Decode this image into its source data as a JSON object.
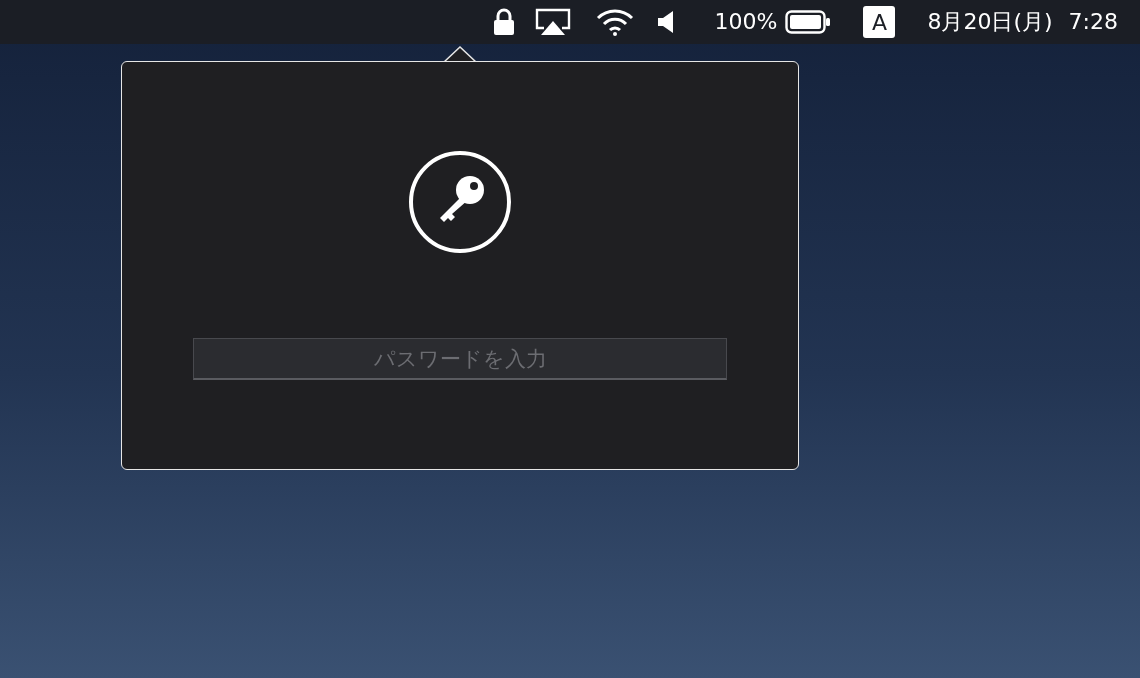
{
  "menu_bar": {
    "items": [
      {
        "kind": "lock"
      },
      {
        "kind": "airplay"
      },
      {
        "kind": "wifi"
      },
      {
        "kind": "volume"
      },
      {
        "kind": "battery",
        "text": "100%"
      },
      {
        "kind": "input_source",
        "text": "A"
      },
      {
        "kind": "clock",
        "date": "8月20日(月)",
        "time": "7:28"
      }
    ]
  },
  "popover": {
    "password_field": {
      "placeholder": "パスワードを入力"
    }
  }
}
